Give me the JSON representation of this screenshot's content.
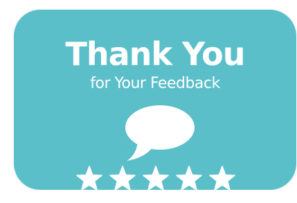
{
  "card": {
    "title": "Thank You",
    "subtitle": "for Your Feedback",
    "icon": "speech-bubble-icon",
    "rating": {
      "value": 5,
      "max": 5,
      "icon": "star-icon"
    },
    "colors": {
      "background": "#5bbfca",
      "foreground": "#ffffff"
    }
  }
}
